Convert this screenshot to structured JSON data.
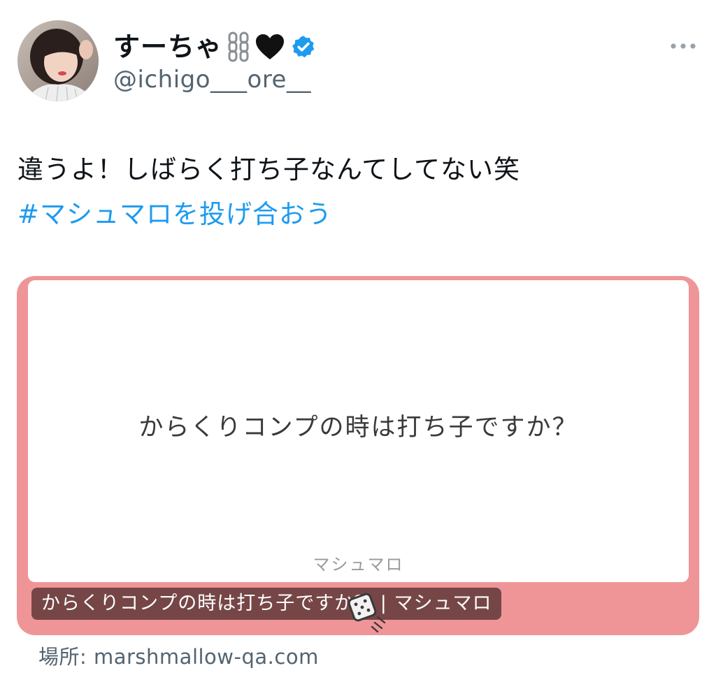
{
  "author": {
    "display_name": "すーちゃ",
    "handle": "@ichigo___ore__",
    "name_emojis": [
      "chain-icon",
      "black-heart-icon"
    ],
    "verified": true,
    "verified_color": "#1d9bf0"
  },
  "tweet": {
    "text": "違うよ！しばらく打ち子なんてしてない笑",
    "hashtag": "#マシュマロを投げ合おう",
    "hashtag_color": "#1d9bf0"
  },
  "link_card": {
    "question": "からくりコンプの時は打ち子ですか？",
    "brand": "マシュマロ",
    "caption": "からくりコンプの時は打ち子ですか？ | マシュマロ",
    "domain": "場所: marshmallow-qa.com",
    "frame_color": "#ef9598"
  },
  "icons": {
    "more": "more-horizontal-icon",
    "dice": "marshmallow-dice-icon",
    "verified": "verified-badge-icon"
  }
}
